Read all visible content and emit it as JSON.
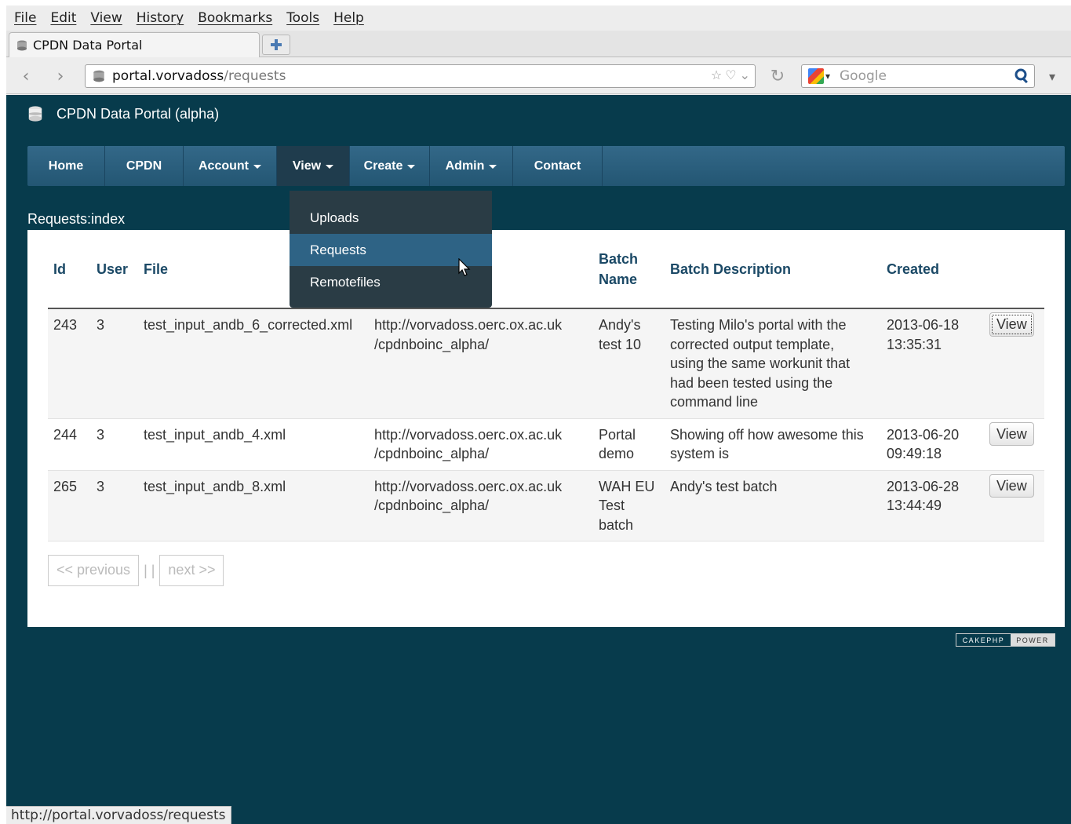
{
  "menubar": [
    "File",
    "Edit",
    "View",
    "History",
    "Bookmarks",
    "Tools",
    "Help"
  ],
  "tab": {
    "title": "CPDN Data Portal"
  },
  "url": {
    "host": "portal.vorvadoss",
    "path": "/requests"
  },
  "search": {
    "placeholder": "Google"
  },
  "site": {
    "brand": "CPDN Data Portal (alpha)"
  },
  "nav": [
    {
      "label": "Home",
      "caret": false
    },
    {
      "label": "CPDN",
      "caret": false
    },
    {
      "label": "Account",
      "caret": true
    },
    {
      "label": "View",
      "caret": true,
      "active": true
    },
    {
      "label": "Create",
      "caret": true
    },
    {
      "label": "Admin",
      "caret": true
    },
    {
      "label": "Contact",
      "caret": false
    }
  ],
  "dropdown": [
    "Uploads",
    "Requests",
    "Remotefiles"
  ],
  "breadcrumb": "Requests:index",
  "table": {
    "headers": {
      "id": "Id",
      "user": "User",
      "file": "File",
      "batch_name_1": "Batch",
      "batch_name_2": "Name",
      "batch_desc": "Batch Description",
      "created": "Created"
    },
    "rows": [
      {
        "id": "243",
        "user": "3",
        "file": "test_input_andb_6_corrected.xml",
        "url1": "http://vorvadoss.oerc.ox.ac.uk",
        "url2": "/cpdnboinc_alpha/",
        "batch_name": [
          "Andy's",
          "test 10"
        ],
        "desc": [
          "Testing Milo's portal with the",
          "corrected output template,",
          "using the same workunit that",
          "had been tested using the",
          "command line"
        ],
        "created": [
          "2013-06-18",
          "13:35:31"
        ],
        "action": "View"
      },
      {
        "id": "244",
        "user": "3",
        "file": "test_input_andb_4.xml",
        "url1": "http://vorvadoss.oerc.ox.ac.uk",
        "url2": "/cpdnboinc_alpha/",
        "batch_name": [
          "Portal",
          "demo"
        ],
        "desc": [
          "Showing off how awesome this",
          "system is"
        ],
        "created": [
          "2013-06-20",
          "09:49:18"
        ],
        "action": "View"
      },
      {
        "id": "265",
        "user": "3",
        "file": "test_input_andb_8.xml",
        "url1": "http://vorvadoss.oerc.ox.ac.uk",
        "url2": "/cpdnboinc_alpha/",
        "batch_name": [
          "WAH EU",
          "Test",
          "batch"
        ],
        "desc": [
          "Andy's test batch"
        ],
        "created": [
          "2013-06-28",
          "13:44:49"
        ],
        "action": "View"
      }
    ]
  },
  "pager": {
    "prev": "<< previous",
    "sep": "| |",
    "next": "next >>"
  },
  "badge": {
    "left": "CAKEPHP",
    "right": "POWER"
  },
  "status": "http://portal.vorvadoss/requests",
  "colors": {
    "page_bg": "#073b4c",
    "nav": "#2a5f7f",
    "dropdown_hl": "#2e6385",
    "header_text": "#1b4966"
  }
}
